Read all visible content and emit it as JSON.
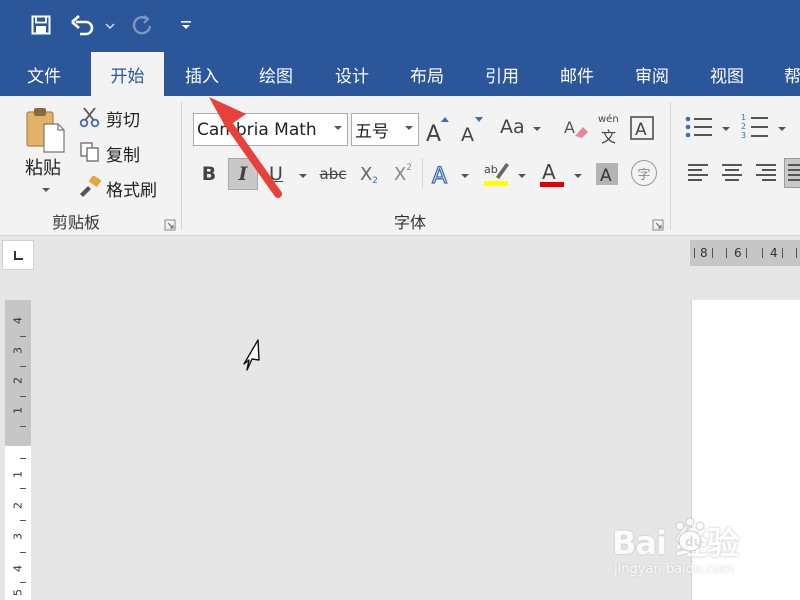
{
  "tabs": [
    "文件",
    "开始",
    "插入",
    "绘图",
    "设计",
    "布局",
    "引用",
    "邮件",
    "审阅",
    "视图",
    "帮"
  ],
  "active_tab": "开始",
  "clipboard": {
    "paste_label": "粘贴",
    "cut_label": "剪切",
    "copy_label": "复制",
    "format_painter_label": "格式刷",
    "group_label": "剪贴板"
  },
  "font": {
    "font_name": "Cambria Math",
    "font_size": "五号",
    "change_case_label": "Aa",
    "phonetic_top": "wén",
    "phonetic_bottom": "文",
    "bold_label": "B",
    "italic_label": "I",
    "underline_label": "U",
    "strike_label": "abc",
    "sub_label": "X",
    "sub_mark": "2",
    "sup_label": "X",
    "sup_mark": "2",
    "enclose_label": "字",
    "highlight_mark": "ab",
    "group_label": "字体"
  },
  "paragraph": {
    "number_marks": [
      "1",
      "2",
      "3"
    ]
  },
  "rulers": {
    "horizontal_numbers": [
      "8",
      "6",
      "4"
    ],
    "vertical_numbers_upper": [
      "4",
      "3",
      "2",
      "1"
    ],
    "vertical_numbers_lower": [
      "1",
      "2",
      "3",
      "4",
      "5"
    ]
  },
  "watermark": {
    "main": "Bai  经验",
    "sub": "jingyan.baidu.com"
  },
  "colors": {
    "title_blue": "#2b579a",
    "highlight_yellow": "#ffff00",
    "font_color_red": "#e00000",
    "arrow_red": "#e8403a"
  }
}
